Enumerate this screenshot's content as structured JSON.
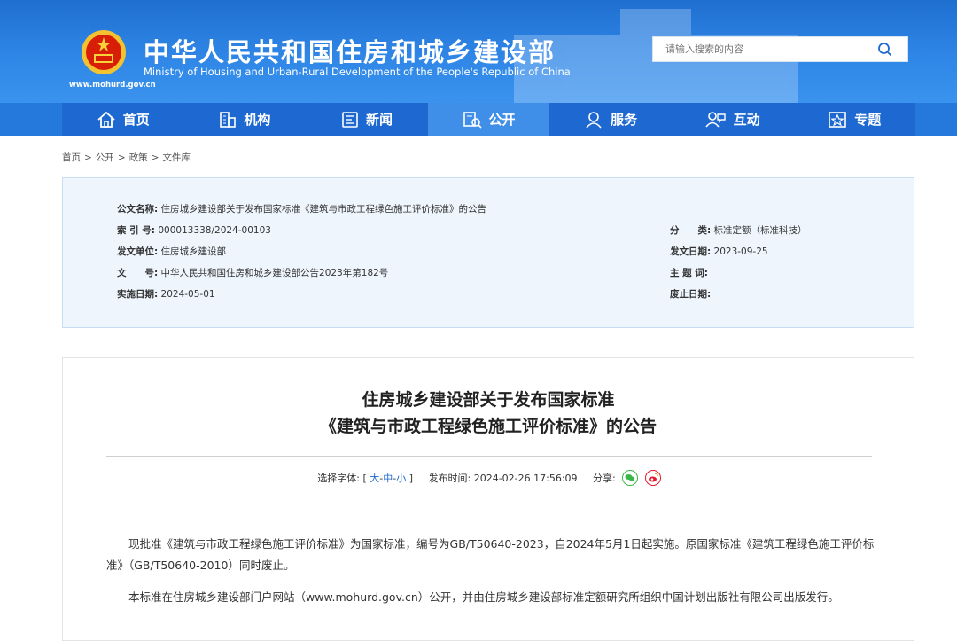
{
  "header": {
    "title": "中华人民共和国住房和城乡建设部",
    "subtitle": "Ministry of Housing and Urban-Rural Development of the People's Republic of China",
    "url": "www.mohurd.gov.cn",
    "search_placeholder": "请输入搜索的内容"
  },
  "nav": {
    "active": "公开",
    "items": [
      {
        "label": "首页",
        "icon": "home-icon"
      },
      {
        "label": "机构",
        "icon": "building-icon"
      },
      {
        "label": "新闻",
        "icon": "news-icon"
      },
      {
        "label": "公开",
        "icon": "open-icon"
      },
      {
        "label": "服务",
        "icon": "service-icon"
      },
      {
        "label": "互动",
        "icon": "interact-icon"
      },
      {
        "label": "专题",
        "icon": "topic-icon"
      }
    ]
  },
  "breadcrumb": {
    "items": [
      "首页",
      "公开",
      "政策",
      "文件库"
    ],
    "separator": ">"
  },
  "info": {
    "title_k": "公文名称:",
    "title_v": "住房城乡建设部关于发布国家标准《建筑与市政工程绿色施工评价标准》的公告",
    "index_k": "索 引 号:",
    "index_v": "000013338/2024-00103",
    "issuer_k": "发文单位:",
    "issuer_v": "住房城乡建设部",
    "docno_k": "文　　号:",
    "docno_v": "中华人民共和国住房和城乡建设部公告2023年第182号",
    "impl_k": "实施日期:",
    "impl_v": "2024-05-01",
    "category_k": "分　　类:",
    "category_v": "标准定额（标准科技）",
    "date_k": "发文日期:",
    "date_v": "2023-09-25",
    "subject_k": "主 题 词:",
    "subject_v": "",
    "expire_k": "废止日期:",
    "expire_v": ""
  },
  "article": {
    "title_line1": "住房城乡建设部关于发布国家标准",
    "title_line2": "《建筑与市政工程绿色施工评价标准》的公告",
    "font_label": "选择字体:",
    "bracket_open": "[",
    "size_large": "大",
    "size_medium": "中",
    "size_small": "小",
    "bracket_close": "]",
    "dash": "-",
    "publish_label": "发布时间:",
    "publish_time": "2024-02-26 17:56:09",
    "share_label": "分享:",
    "para1": "现批准《建筑与市政工程绿色施工评价标准》为国家标准，编号为GB/T50640-2023，自2024年5月1日起实施。原国家标准《建筑工程绿色施工评价标准》（GB/T50640-2010）同时废止。",
    "para2": "本标准在住房城乡建设部门户网站（www.mohurd.gov.cn）公开，并由住房城乡建设部标准定额研究所组织中国计划出版社有限公司出版发行。"
  },
  "colors": {
    "header_blue": "#2f86e6",
    "nav_blue": "#1e69d1",
    "nav_active": "#3f8fe9",
    "info_bg": "#eef5fd",
    "link_blue": "#1e69d1"
  }
}
